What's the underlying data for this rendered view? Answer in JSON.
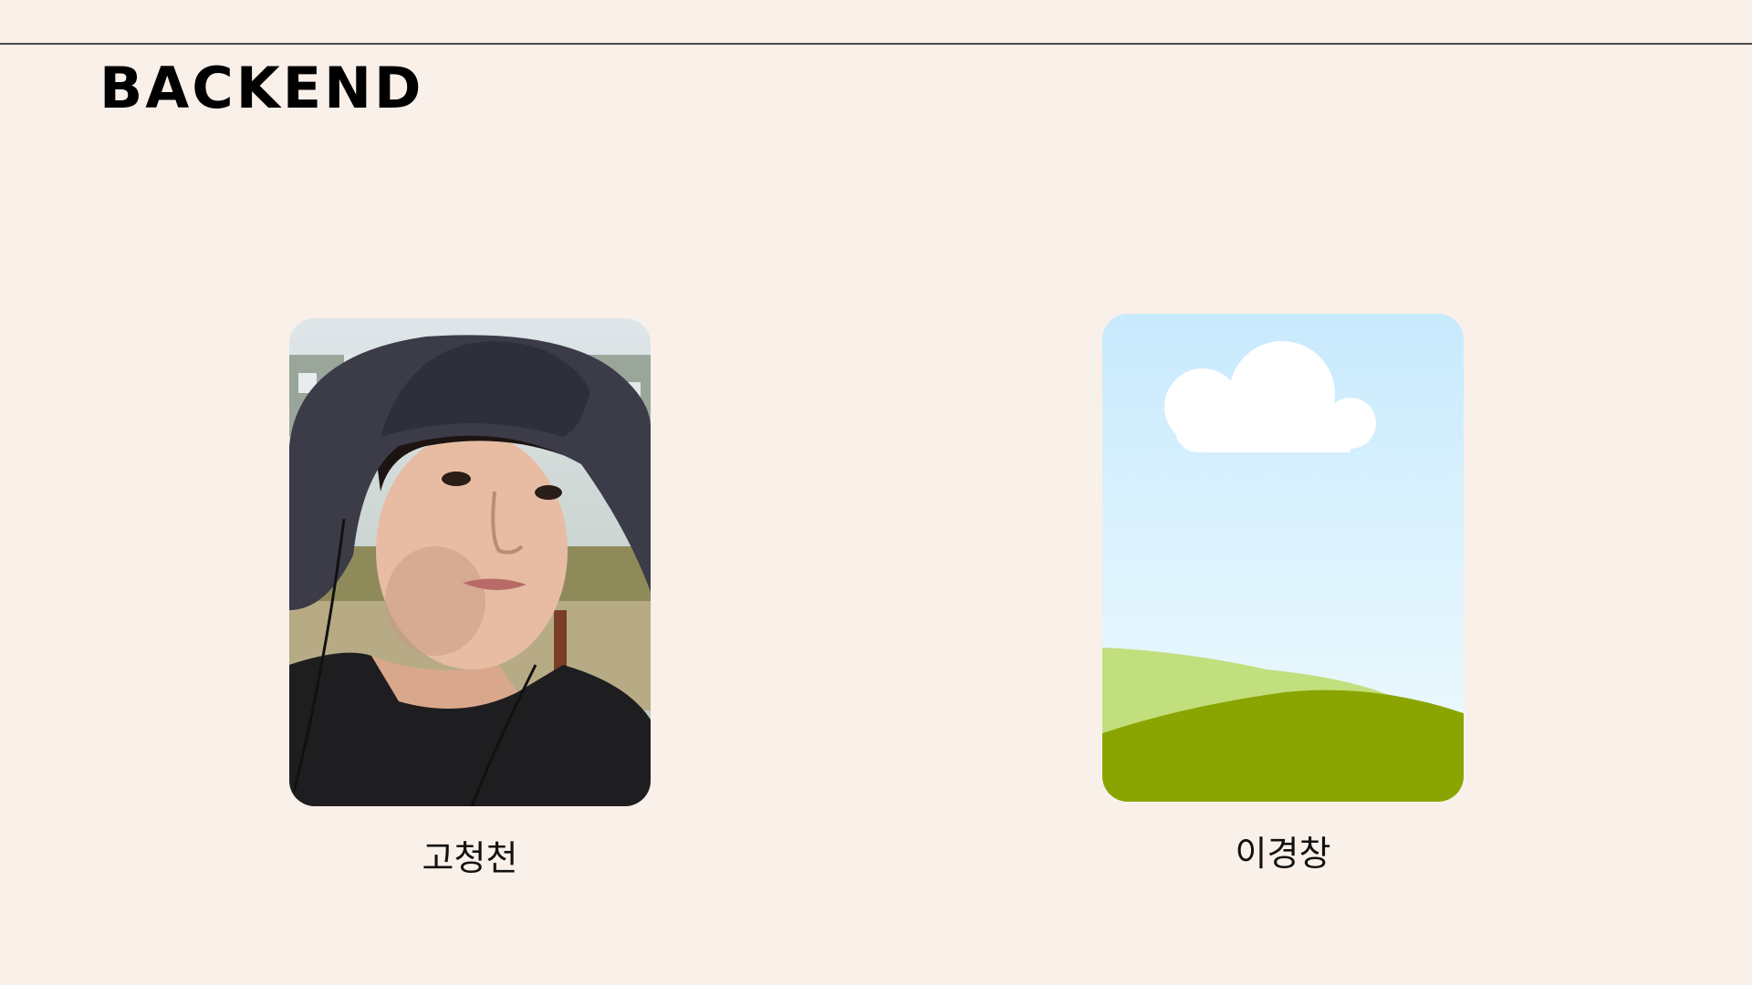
{
  "section": {
    "title": "BACKEND"
  },
  "members": [
    {
      "name": "고청천",
      "photo": "portrait-photo"
    },
    {
      "name": "이경창",
      "photo": "landscape-placeholder-image"
    }
  ],
  "colors": {
    "background": "#f9f0ea",
    "sky_top": "#c8eafd",
    "sky_bottom": "#f1fbfd",
    "hill_light": "#c2df7e",
    "hill_dark": "#8aa502"
  }
}
